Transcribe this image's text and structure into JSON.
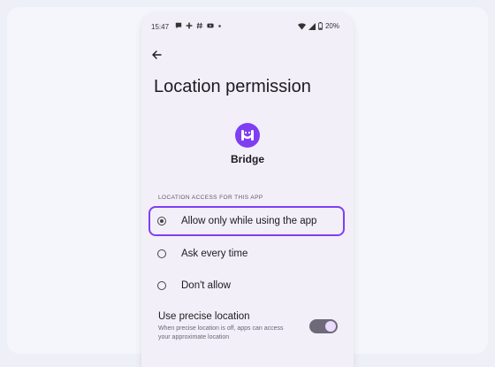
{
  "status_bar": {
    "time": "15:47",
    "notification_icons": [
      "chat-bubble-icon",
      "slack-icon",
      "hashtag-icon",
      "youtube-icon",
      "dot-icon"
    ],
    "battery": "20%"
  },
  "page": {
    "title": "Location permission"
  },
  "app": {
    "name": "Bridge",
    "icon": "bridge-app-icon",
    "brand_color": "#7e3ff2"
  },
  "section_header": "LOCATION ACCESS FOR THIS APP",
  "options": [
    {
      "label": "Allow only while using the app",
      "selected": true
    },
    {
      "label": "Ask every time",
      "selected": false
    },
    {
      "label": "Don't allow",
      "selected": false
    }
  ],
  "precise_location": {
    "title": "Use precise location",
    "description": "When precise location is off, apps can access your approximate location",
    "enabled": true
  }
}
